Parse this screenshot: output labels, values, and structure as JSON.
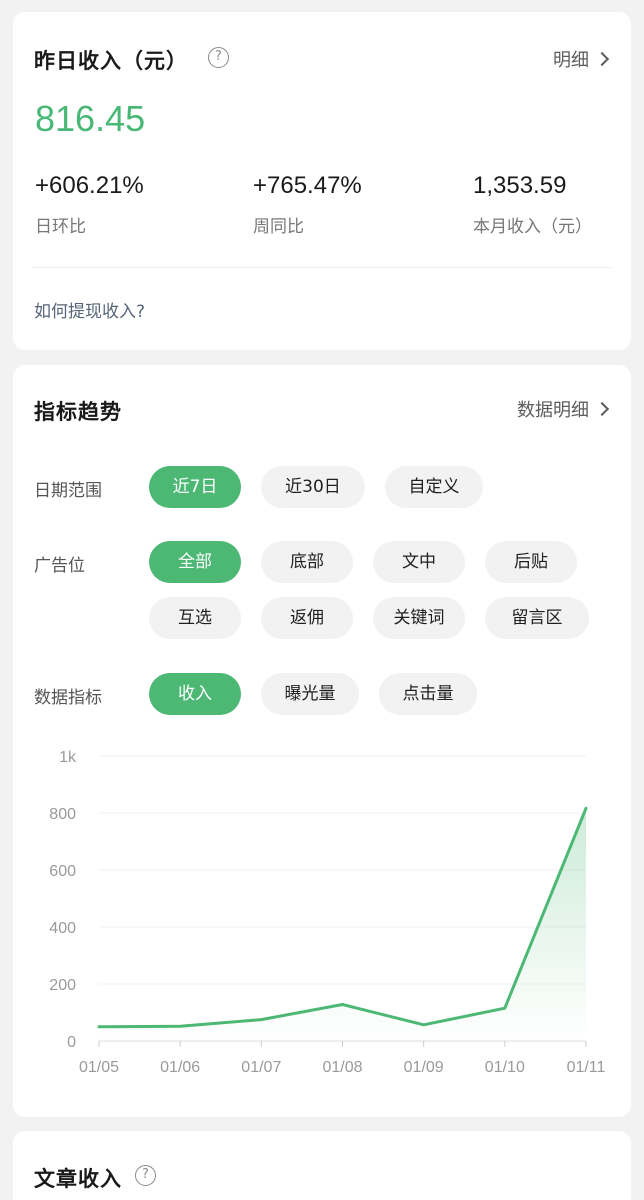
{
  "income": {
    "title": "昨日收入（元）",
    "help_icon": "?",
    "detail_link": "明细",
    "yesterday_value": "816.45",
    "stats": [
      {
        "value": "+606.21%",
        "label": "日环比"
      },
      {
        "value": "+765.47%",
        "label": "周同比"
      },
      {
        "value": "1,353.59",
        "label": "本月收入（元）"
      }
    ],
    "withdraw_link": "如何提现收入?"
  },
  "trend": {
    "title": "指标趋势",
    "detail_link": "数据明细",
    "date_range": {
      "label": "日期范围",
      "options": [
        "近7日",
        "近30日",
        "自定义"
      ],
      "selected": "近7日"
    },
    "ad_position": {
      "label": "广告位",
      "options": [
        "全部",
        "底部",
        "文中",
        "后贴",
        "互选",
        "返佣",
        "关键词",
        "留言区"
      ],
      "selected": "全部"
    },
    "metric": {
      "label": "数据指标",
      "options": [
        "收入",
        "曝光量",
        "点击量"
      ],
      "selected": "收入"
    }
  },
  "chart_data": {
    "type": "area",
    "x": [
      "01/05",
      "01/06",
      "01/07",
      "01/08",
      "01/09",
      "01/10",
      "01/11"
    ],
    "series": [
      {
        "values": [
          50,
          52,
          75,
          128,
          57,
          115,
          816.45
        ]
      }
    ],
    "ylim": [
      0,
      1000
    ],
    "yticks": [
      0,
      200,
      400,
      600,
      800,
      1000
    ],
    "ytick_labels": [
      "0",
      "200",
      "400",
      "600",
      "800",
      "1k"
    ],
    "grid": true,
    "color": "#4cb874",
    "legend": "none"
  },
  "article": {
    "title": "文章收入",
    "help_icon": "?"
  }
}
